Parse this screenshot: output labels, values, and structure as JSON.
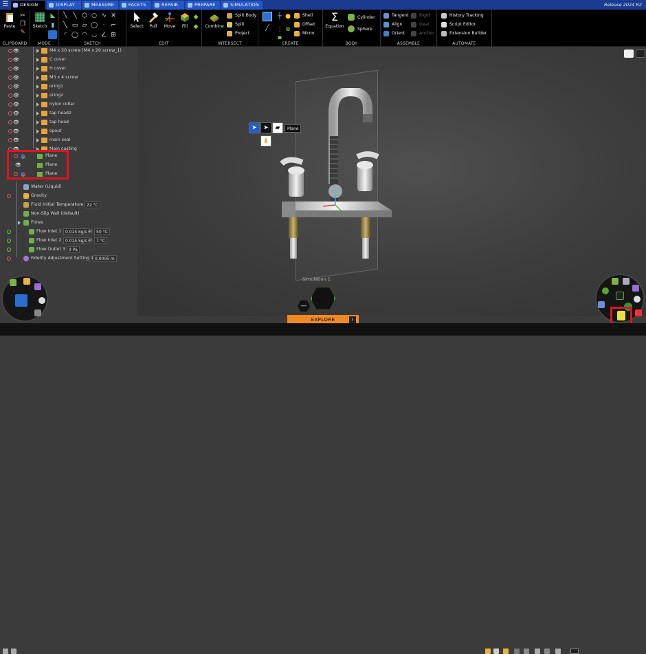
{
  "release": "Release 2024 R2",
  "tabs": [
    "Design",
    "Display",
    "Measure",
    "Facets",
    "Repair",
    "Prepare",
    "Simulation"
  ],
  "ribbon": {
    "clipboard": {
      "title": "Clipboard",
      "paste": "Paste"
    },
    "mode": {
      "title": "Mode",
      "sketch": "Sketch"
    },
    "sketch": {
      "title": "Sketch"
    },
    "edit": {
      "title": "Edit",
      "select": "Select",
      "pull": "Pull",
      "move": "Move",
      "fill": "Fill"
    },
    "intersect": {
      "title": "Intersect",
      "combine": "Combine",
      "split_body": "Split Body",
      "split": "Split",
      "project": "Project"
    },
    "create": {
      "title": "Create",
      "shell": "Shell",
      "offset": "Offset",
      "mirror": "Mirror"
    },
    "body": {
      "title": "Body",
      "equation": "Equation",
      "cylinder": "Cylinder",
      "sphere": "Sphere"
    },
    "assemble": {
      "title": "Assemble",
      "tangent": "Tangent",
      "rigid": "Rigid",
      "align": "Align",
      "gear": "Gear",
      "orient": "Orient",
      "anchor": "Anchor"
    },
    "automate": {
      "title": "Automate",
      "history": "History Tracking",
      "script": "Script Editor",
      "extension": "Extension Builder"
    }
  },
  "tree": {
    "components": [
      "M4 x 20 screw (M4 x 20 screw_1)",
      "C cover",
      "H cover",
      "M3 x 4 screw",
      "oring1",
      "oring2",
      "nylon collar",
      "tap head2",
      "tap head",
      "spout",
      "main seal",
      "Main casting"
    ],
    "planes": [
      "Plane",
      "Plane",
      "Plane"
    ],
    "simulation": {
      "water": "Water (Liquid)",
      "gravity": "Gravity",
      "fluid_temp_label": "Fluid Initial Temperature",
      "fluid_temp_value": "22 °C",
      "wall": "Non-Slip Wall (default)",
      "flows": "Flows",
      "inlet1_label": "Flow Inlet 1",
      "inlet1_rate": "0.015 kg/s",
      "inlet1_at": "at",
      "inlet1_temp": "50 °C",
      "inlet2_label": "Flow Inlet 2",
      "inlet2_rate": "0.015 kg/s",
      "inlet2_at": "at",
      "inlet2_temp": "7 °C",
      "outlet3_label": "Flow Outlet 3",
      "outlet3_value": "0 Pa",
      "fidelity_label": "Fidelity Adjustment Setting 1",
      "fidelity_value": "0.0005 m"
    }
  },
  "viewport": {
    "plane_label": "Plane",
    "simulation_label": "Simulation 1",
    "explore_label": "Explore"
  },
  "colors": {
    "tab_bar": "#1a3b8f",
    "tab": "#2457c5",
    "explore": "#f08a20",
    "highlight": "#e0141e",
    "plane_icon": "#6fb048"
  }
}
